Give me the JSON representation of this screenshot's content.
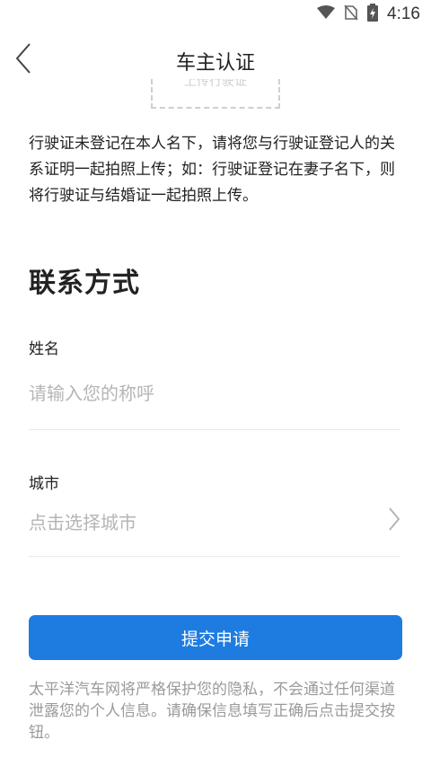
{
  "statusbar": {
    "time": "4:16",
    "icons": [
      "wifi-icon",
      "no-sim-icon",
      "battery-charging-icon"
    ]
  },
  "navbar": {
    "title": "车主认证",
    "back_icon": "chevron-left-icon"
  },
  "upload": {
    "label": "上传行驶证"
  },
  "description": "行驶证未登记在本人名下，请将您与行驶证登记人的关系证明一起拍照上传；如：行驶证登记在妻子名下，则将行驶证与结婚证一起拍照上传。",
  "contact": {
    "section_title": "联系方式",
    "name_label": "姓名",
    "name_placeholder": "请输入您的称呼",
    "name_value": "",
    "city_label": "城市",
    "city_placeholder": "点击选择城市"
  },
  "submit_label": "提交申请",
  "privacy_note": "太平洋汽车网将严格保护您的隐私，不会通过任何渠道泄露您的个人信息。请确保信息填写正确后点击提交按钮。",
  "colors": {
    "accent": "#1e7ce1",
    "placeholder": "#b5b5b5",
    "note": "#9a9a9a"
  }
}
